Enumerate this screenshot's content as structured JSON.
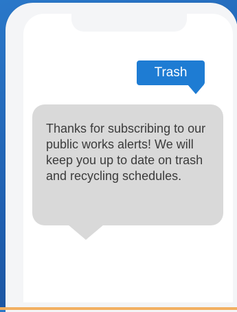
{
  "colors": {
    "background": "#1f5fb0",
    "outgoing_bubble": "#1e7cd3",
    "incoming_bubble": "#d9d9d9",
    "bottom_strip": "#f2b062"
  },
  "messages": [
    {
      "direction": "outgoing",
      "text": "Trash"
    },
    {
      "direction": "incoming",
      "text": "Thanks for subscribing to our public works alerts! We will keep you up to date on trash and recycling schedules."
    }
  ]
}
